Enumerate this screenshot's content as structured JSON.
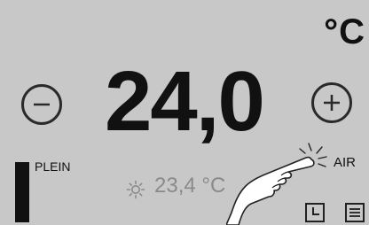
{
  "display": {
    "unit": "°C",
    "setpoint": "24,0",
    "room_temp": "23,4 °C",
    "level_label": "PLEIN",
    "mode_label": "AIR"
  },
  "icons": {
    "minus": "minus-icon",
    "plus": "plus-icon",
    "sun": "sun-icon",
    "clock": "clock-icon",
    "menu": "menu-icon",
    "touch": "pointing-hand-icon"
  },
  "colors": {
    "background": "#c8c8c8",
    "text": "#111111",
    "muted_text": "#8a8a8a"
  }
}
